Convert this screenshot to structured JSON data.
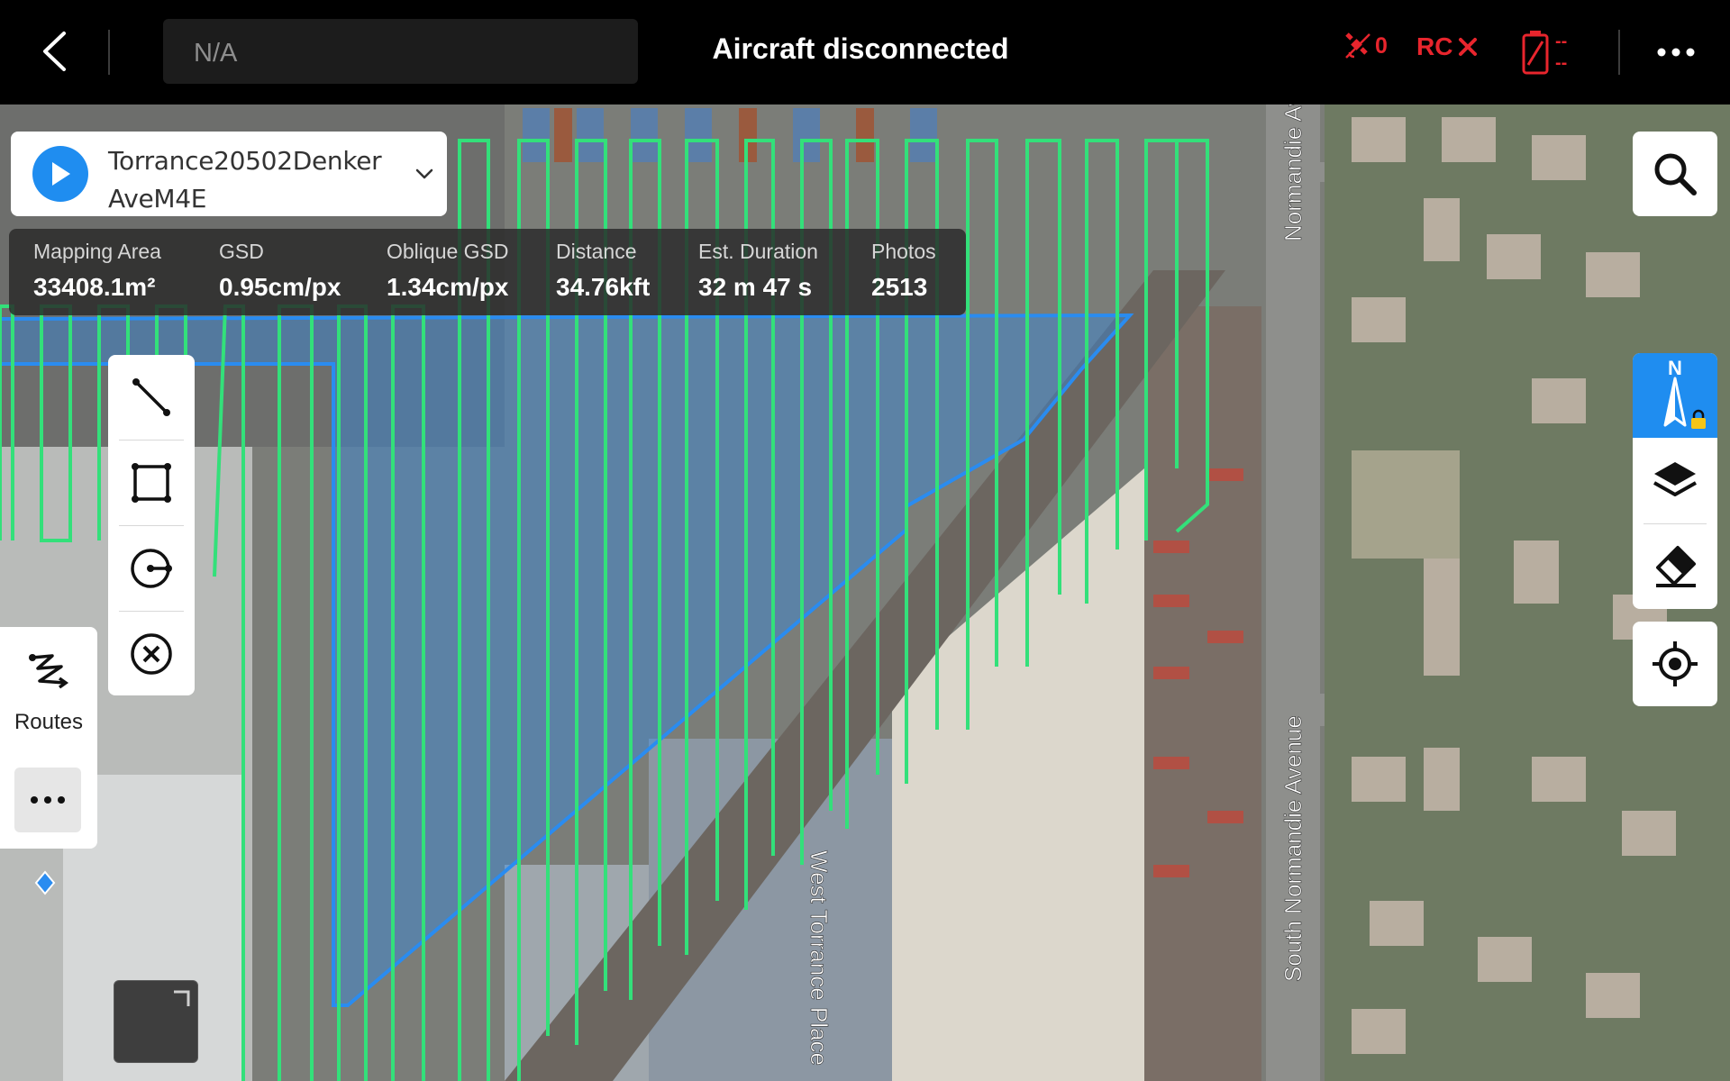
{
  "topbar": {
    "aircraft_name": "N/A",
    "status_title": "Aircraft disconnected",
    "gps_satellites": "0",
    "rc_label": "RC",
    "battery_top": "--",
    "battery_bottom": "--",
    "status_color": "#e8252d"
  },
  "route": {
    "name": "Torrance20502Denker AveM4E"
  },
  "stats": [
    {
      "label": "Mapping Area",
      "value": "33408.1m²"
    },
    {
      "label": "GSD",
      "value": "0.95cm/px"
    },
    {
      "label": "Oblique GSD",
      "value": "1.34cm/px"
    },
    {
      "label": "Distance",
      "value": "34.76kft"
    },
    {
      "label": "Est. Duration",
      "value": "32 m 47 s"
    },
    {
      "label": "Photos",
      "value": "2513"
    }
  ],
  "draw_tools": [
    {
      "icon": "line-draw-icon"
    },
    {
      "icon": "area-draw-icon"
    },
    {
      "icon": "circle-draw-icon"
    },
    {
      "icon": "delete-shape-icon"
    }
  ],
  "routes_panel": {
    "label": "Routes",
    "more_icon": "ellipsis-icon"
  },
  "right_controls": {
    "search_icon": "search-icon",
    "compass_label": "N",
    "layers_icon": "layers-icon",
    "eraser_icon": "eraser-icon",
    "locate_icon": "locate-icon"
  },
  "map": {
    "street_labels": [
      "South Normandie Avenue",
      "Normandie Avenue",
      "West Torrance Place"
    ],
    "polygon_color": "#2a8cf0",
    "flight_line_color": "#33e07a"
  }
}
